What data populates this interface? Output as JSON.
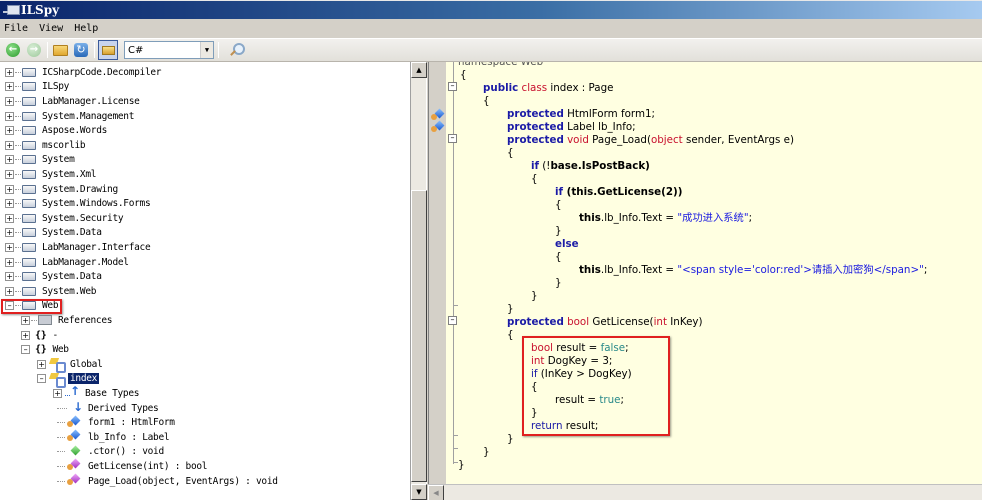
{
  "window": {
    "title": "ILSpy"
  },
  "menu": [
    "File",
    "View",
    "Help"
  ],
  "toolbar": {
    "back_icon": "back-arrow-icon",
    "forward_icon": "forward-arrow-icon",
    "open_icon": "open-folder-icon",
    "reload_icon": "refresh-icon",
    "open_list_icon": "assembly-list-icon",
    "language": "C#",
    "search_icon": "search-icon"
  },
  "tree": {
    "assemblies": [
      "ICSharpCode.Decompiler",
      "ILSpy",
      "LabManager.License",
      "System.Management",
      "Aspose.Words",
      "mscorlib",
      "System",
      "System.Xml",
      "System.Drawing",
      "System.Windows.Forms",
      "System.Security",
      "System.Data",
      "LabManager.Interface",
      "LabManager.Model",
      "System.Data",
      "System.Web"
    ],
    "expanded_assembly": "Web",
    "children": {
      "references": "References",
      "ns_empty": "-",
      "ns_web": "Web",
      "class_global": "Global",
      "class_index": "index",
      "base_types": "Base Types",
      "derived_types": "Derived Types",
      "members": [
        {
          "label": "form1 : HtmlForm",
          "kind": "field"
        },
        {
          "label": "lb_Info : Label",
          "kind": "field"
        },
        {
          "label": ".ctor() : void",
          "kind": "ctor"
        },
        {
          "label": "GetLicense(int) : bool",
          "kind": "method"
        },
        {
          "label": "Page_Load(object, EventArgs) : void",
          "kind": "method"
        }
      ]
    }
  },
  "code": {
    "top_partial": "namespace Web",
    "lines": {
      "l1": "{",
      "l2_kw1": "public",
      "l2_kw2": "class",
      "l2_rest": " index : Page",
      "l3": "{",
      "l4_kw": "protected",
      "l4_rest": " HtmlForm form1;",
      "l5_kw": "protected",
      "l5_rest": " Label lb_Info;",
      "l6_kw": "protected",
      "l6_ty": "void",
      "l6_a": " Page_Load(",
      "l6_ty2": "object",
      "l6_b": " sender, EventArgs e)",
      "l7": "{",
      "l8_kw": "if",
      "l8_a": " (!",
      "l8_b": "base",
      "l8_c": ".IsPostBack)",
      "l9": "{",
      "l10_kw": "if",
      "l10_a": " (",
      "l10_b": "this",
      "l10_c": ".GetLicense(2))",
      "l11": "{",
      "l12_this": "this",
      "l12_a": ".lb_Info.Text = ",
      "l12_str": "\"成功进入系统\"",
      "l12_end": ";",
      "l13": "}",
      "l14_kw": "else",
      "l15": "{",
      "l16_this": "this",
      "l16_a": ".lb_Info.Text = ",
      "l16_str": "\"<span style='color:red'>请插入加密狗</span>\"",
      "l16_end": ";",
      "l17": "}",
      "l18": "}",
      "l19": "}",
      "l20_kw": "protected",
      "l20_ty": "bool",
      "l20_a": " GetLicense(",
      "l20_ty2": "int",
      "l20_b": " InKey)",
      "l21": "{",
      "l22_ty": "bool",
      "l22_a": " result = ",
      "l22_lit": "false",
      "l22_end": ";",
      "l23_ty": "int",
      "l23_a": " DogKey = 3;",
      "l24_kw": "if",
      "l24_a": " (InKey > DogKey)",
      "l25": "{",
      "l26_a": "result = ",
      "l26_lit": "true",
      "l26_end": ";",
      "l27": "}",
      "l28_kw": "return",
      "l28_a": " result;",
      "l29": "}",
      "l30": "}",
      "l31": "}"
    }
  },
  "colors": {
    "keyword": "#1a1aa6",
    "type_keyword": "#c8102e",
    "literal": "#2a8a8a",
    "string": "#1a1ae0",
    "code_background": "#ffffe1",
    "highlight_box": "#e02020",
    "selection": "#0a246a"
  }
}
